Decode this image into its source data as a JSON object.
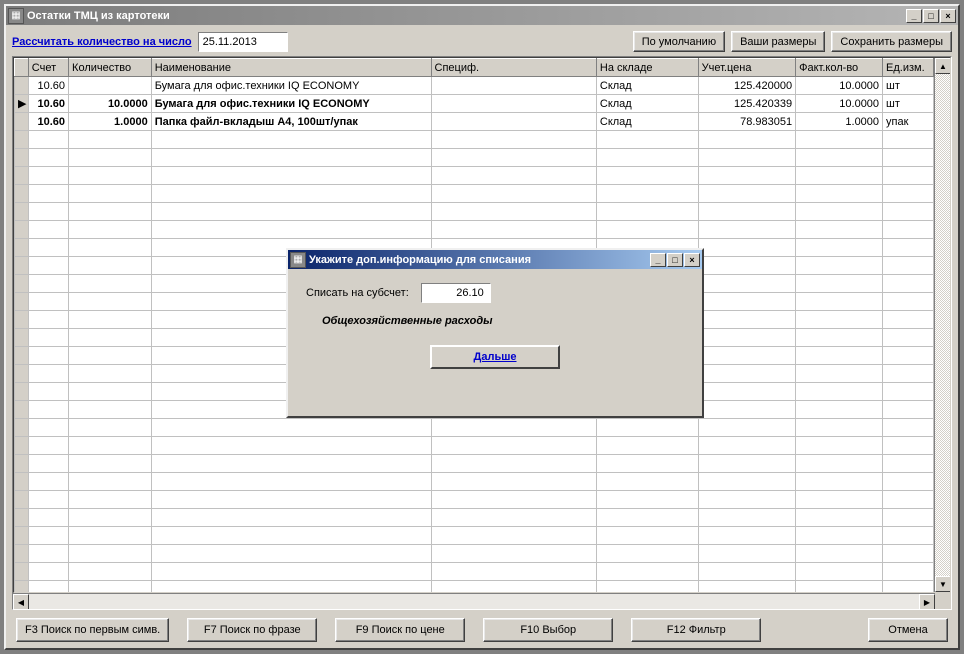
{
  "main": {
    "title": "Остатки ТМЦ из картотеки",
    "calc_label": "Рассчитать количество на число",
    "date_value": "25.11.2013",
    "btn_default": "По умолчанию",
    "btn_your_sizes": "Ваши размеры",
    "btn_save_sizes": "Сохранить размеры"
  },
  "grid": {
    "headers": {
      "acct": "Счет",
      "qty": "Количество",
      "name": "Наименование",
      "spec": "Специф.",
      "wh": "На складе",
      "price": "Учет.цена",
      "fact": "Факт.кол-во",
      "unit": "Ед.изм."
    },
    "rows": [
      {
        "marker": "",
        "acct": "10.60",
        "qty": "",
        "name": "Бумага для офис.техники IQ ECONOMY",
        "spec": "",
        "wh": "Склад",
        "price": "125.420000",
        "fact": "10.0000",
        "unit": "шт",
        "bold": false
      },
      {
        "marker": "▶",
        "acct": "10.60",
        "qty": "10.0000",
        "name": "Бумага для офис.техники IQ ECONOMY",
        "spec": "",
        "wh": "Склад",
        "price": "125.420339",
        "fact": "10.0000",
        "unit": "шт",
        "bold": true
      },
      {
        "marker": "",
        "acct": "10.60",
        "qty": "1.0000",
        "name": "Папка файл-вкладыш А4, 100шт/упак",
        "spec": "",
        "wh": "Склад",
        "price": "78.983051",
        "fact": "1.0000",
        "unit": "упак",
        "bold": true
      }
    ]
  },
  "footer": {
    "f3": "F3 Поиск по первым симв.",
    "f7": "F7 Поиск по фразе",
    "f9": "F9 Поиск по цене",
    "f10": "F10 Выбор",
    "f12": "F12 Фильтр",
    "cancel": "Отмена"
  },
  "dialog": {
    "title": "Укажите доп.информацию для списания",
    "field_label": "Списать на субсчет:",
    "subacct_value": "26.10",
    "desc": "Общехозяйственные расходы",
    "next": "Дальше"
  }
}
